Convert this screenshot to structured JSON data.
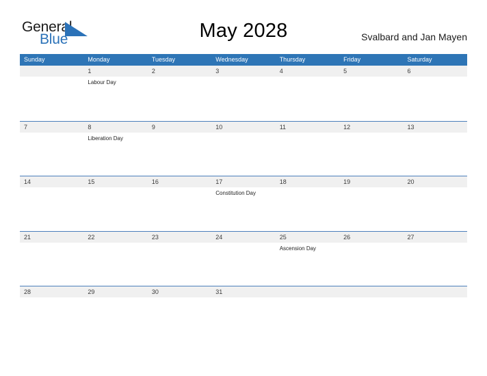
{
  "brand": {
    "name_part1": "General",
    "name_part2": "Blue",
    "mark_icon": "blue-triangle-flag-icon",
    "accent_color": "#2b72b8"
  },
  "header": {
    "title": "May 2028",
    "region": "Svalbard and Jan Mayen"
  },
  "calendar": {
    "header_background": "#2e75b6",
    "band_background": "#f0f0f0",
    "row_separator_color": "#4a7ebb",
    "day_names": [
      "Sunday",
      "Monday",
      "Tuesday",
      "Wednesday",
      "Thursday",
      "Friday",
      "Saturday"
    ],
    "weeks": [
      [
        {
          "day": "",
          "events": []
        },
        {
          "day": "1",
          "events": [
            "Labour Day"
          ]
        },
        {
          "day": "2",
          "events": []
        },
        {
          "day": "3",
          "events": []
        },
        {
          "day": "4",
          "events": []
        },
        {
          "day": "5",
          "events": []
        },
        {
          "day": "6",
          "events": []
        }
      ],
      [
        {
          "day": "7",
          "events": []
        },
        {
          "day": "8",
          "events": [
            "Liberation Day"
          ]
        },
        {
          "day": "9",
          "events": []
        },
        {
          "day": "10",
          "events": []
        },
        {
          "day": "11",
          "events": []
        },
        {
          "day": "12",
          "events": []
        },
        {
          "day": "13",
          "events": []
        }
      ],
      [
        {
          "day": "14",
          "events": []
        },
        {
          "day": "15",
          "events": []
        },
        {
          "day": "16",
          "events": []
        },
        {
          "day": "17",
          "events": [
            "Constitution Day"
          ]
        },
        {
          "day": "18",
          "events": []
        },
        {
          "day": "19",
          "events": []
        },
        {
          "day": "20",
          "events": []
        }
      ],
      [
        {
          "day": "21",
          "events": []
        },
        {
          "day": "22",
          "events": []
        },
        {
          "day": "23",
          "events": []
        },
        {
          "day": "24",
          "events": []
        },
        {
          "day": "25",
          "events": [
            "Ascension Day"
          ]
        },
        {
          "day": "26",
          "events": []
        },
        {
          "day": "27",
          "events": []
        }
      ],
      [
        {
          "day": "28",
          "events": []
        },
        {
          "day": "29",
          "events": []
        },
        {
          "day": "30",
          "events": []
        },
        {
          "day": "31",
          "events": []
        },
        {
          "day": "",
          "events": []
        },
        {
          "day": "",
          "events": []
        },
        {
          "day": "",
          "events": []
        }
      ]
    ]
  }
}
